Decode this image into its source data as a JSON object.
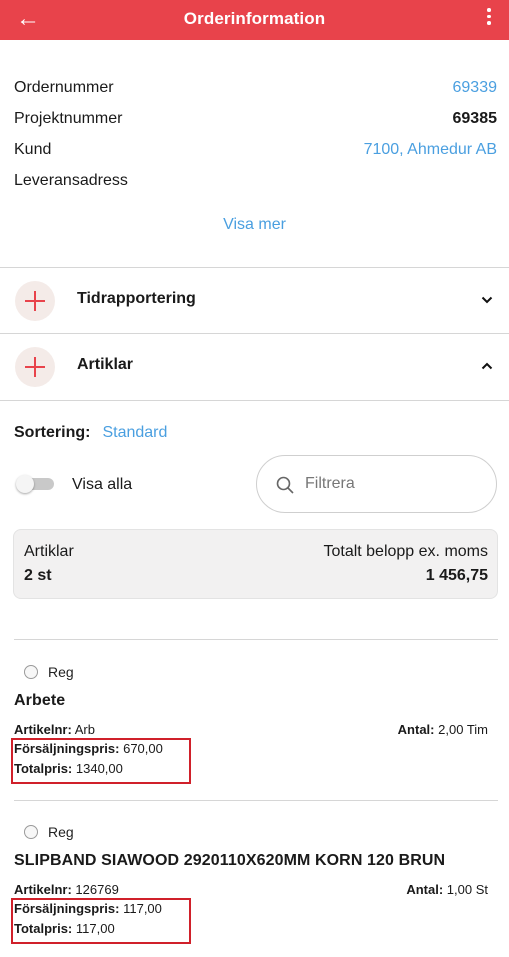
{
  "header": {
    "title": "Orderinformation",
    "back_icon": "arrow-left-icon",
    "more_icon": "more-vertical-icon",
    "color": "#e8434b"
  },
  "info": {
    "order_label": "Ordernummer",
    "order_value": "69339",
    "project_label": "Projektnummer",
    "project_value": "69385",
    "customer_label": "Kund",
    "customer_value": "7100, Ahmedur AB",
    "address_label": "Leveransadress",
    "show_more": "Visa mer"
  },
  "sections": {
    "time": {
      "label": "Tidrapportering",
      "expanded": false
    },
    "articles": {
      "label": "Artiklar",
      "expanded": true
    }
  },
  "sorting": {
    "label": "Sortering:",
    "value": "Standard"
  },
  "toggle": {
    "label": "Visa alla",
    "on": false
  },
  "filter": {
    "placeholder": "Filtrera"
  },
  "summary": {
    "articles_label": "Artiklar",
    "articles_value": "2 st",
    "total_label": "Totalt belopp ex. moms",
    "total_value": "1 456,75"
  },
  "items": [
    {
      "reg": "Reg",
      "name": "Arbete",
      "artnr_label": "Artikelnr:",
      "artnr_value": "Arb",
      "qty_label": "Antal:",
      "qty_value": "2,00 Tim",
      "price_label": "Försäljningspris:",
      "price_value": "670,00",
      "total_label": "Totalpris:",
      "total_value": "1340,00"
    },
    {
      "reg": "Reg",
      "name": "SLIPBAND SIAWOOD 2920110X620MM KORN 120 BRUN",
      "artnr_label": "Artikelnr:",
      "artnr_value": "126769",
      "qty_label": "Antal:",
      "qty_value": "1,00 St",
      "price_label": "Försäljningspris:",
      "price_value": "117,00",
      "total_label": "Totalpris:",
      "total_value": "117,00"
    }
  ]
}
